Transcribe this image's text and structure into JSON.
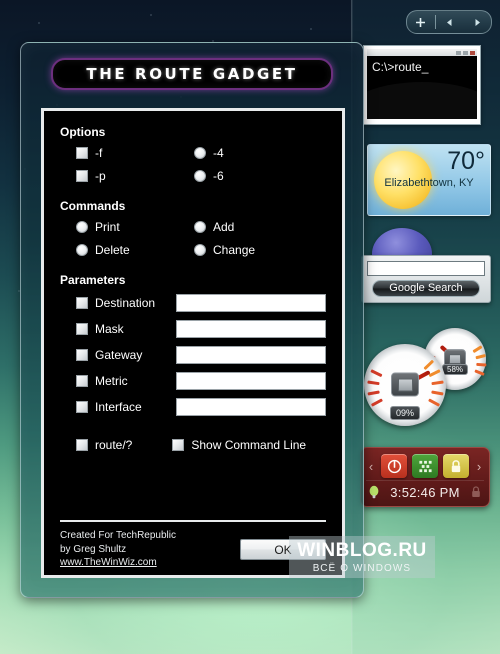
{
  "sidebar": {
    "toolbar": {
      "add_label": "+",
      "prev_label": "◀",
      "next_label": "▶"
    },
    "gadgets": {
      "command_prompt": {
        "name": "command-prompt-gadget",
        "screen_text": "C:\\>route_"
      },
      "weather": {
        "temperature": "70°",
        "location": "Elizabethtown, KY"
      },
      "search": {
        "input_value": "",
        "placeholder": "",
        "button_label": "Google Search"
      },
      "meters": {
        "cpu_value": "09%",
        "memory_value": "58%"
      },
      "control_panel": {
        "prev_label": "‹",
        "next_label": "›",
        "power_icon": "power-icon",
        "network_icon": "network-icon",
        "lock_icon": "lock-icon",
        "time": "3:52:46 PM"
      }
    }
  },
  "route_gadget": {
    "title": "THE ROUTE GADGET",
    "options": {
      "heading": "Options",
      "checkboxes": [
        {
          "label": "-f",
          "checked": false
        },
        {
          "label": "-p",
          "checked": false
        }
      ],
      "radios": [
        {
          "label": "-4",
          "checked": false
        },
        {
          "label": "-6",
          "checked": false
        }
      ]
    },
    "commands": {
      "heading": "Commands",
      "left": [
        {
          "label": "Print",
          "checked": false
        },
        {
          "label": "Delete",
          "checked": false
        }
      ],
      "right": [
        {
          "label": "Add",
          "checked": false
        },
        {
          "label": "Change",
          "checked": false
        }
      ]
    },
    "parameters": {
      "heading": "Parameters",
      "rows": [
        {
          "label": "Destination",
          "value": "",
          "checked": false
        },
        {
          "label": "Mask",
          "value": "",
          "checked": false
        },
        {
          "label": "Gateway",
          "value": "",
          "checked": false
        },
        {
          "label": "Metric",
          "value": "",
          "checked": false
        },
        {
          "label": "Interface",
          "value": "",
          "checked": false
        }
      ]
    },
    "bottom_checks": [
      {
        "label": "route/?",
        "checked": false
      },
      {
        "label": "Show Command Line",
        "checked": false
      }
    ],
    "footer": {
      "line1": "Created For TechRepublic",
      "line2": "by Greg Shultz",
      "link": "www.TheWinWiz.com",
      "ok_label": "OK"
    }
  },
  "watermark": {
    "main": "WINBLOG.RU",
    "sub": "ВСЁ О WINDOWS"
  }
}
